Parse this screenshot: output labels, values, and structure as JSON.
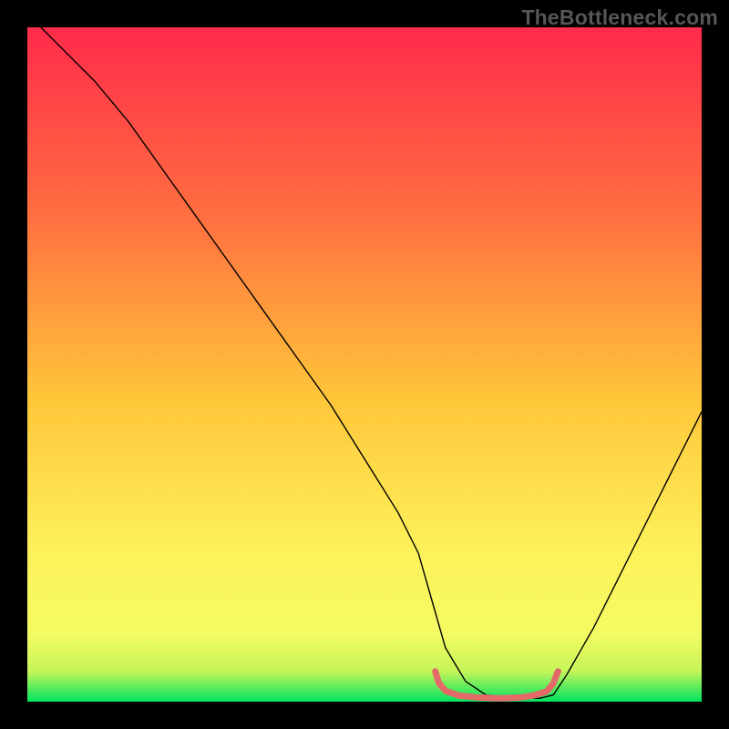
{
  "watermark": "TheBottleneck.com",
  "chart_data": {
    "type": "line",
    "title": "",
    "xlabel": "",
    "ylabel": "",
    "xlim": [
      0,
      100
    ],
    "ylim": [
      0,
      100
    ],
    "grid": false,
    "legend": false,
    "background_gradient": {
      "top": "#ff2b4b",
      "mid_upper": "#ff7540",
      "mid": "#ffd23a",
      "mid_lower": "#fdf85c",
      "bottom": "#00e35f"
    },
    "series": [
      {
        "name": "bottleneck-curve",
        "stroke": "#000000",
        "stroke_width": 1.4,
        "x": [
          2,
          6,
          10,
          15,
          20,
          25,
          30,
          35,
          40,
          45,
          50,
          55,
          58,
          60,
          62,
          65,
          68,
          72,
          76,
          78,
          80,
          84,
          88,
          92,
          96,
          100
        ],
        "y": [
          100,
          96,
          92,
          86,
          79,
          72,
          65,
          58,
          51,
          44,
          36,
          28,
          22,
          15,
          8,
          3,
          1,
          0.5,
          0.5,
          1,
          4,
          11,
          19,
          27,
          35,
          43
        ]
      },
      {
        "name": "optimal-band-marker",
        "stroke": "#e46a6a",
        "stroke_width": 5,
        "x": [
          60.5,
          61,
          62,
          64,
          67,
          70,
          73,
          75,
          77,
          78,
          78.7
        ],
        "y": [
          4.5,
          2.8,
          1.6,
          0.9,
          0.6,
          0.5,
          0.6,
          0.9,
          1.5,
          2.7,
          4.5
        ]
      }
    ]
  }
}
